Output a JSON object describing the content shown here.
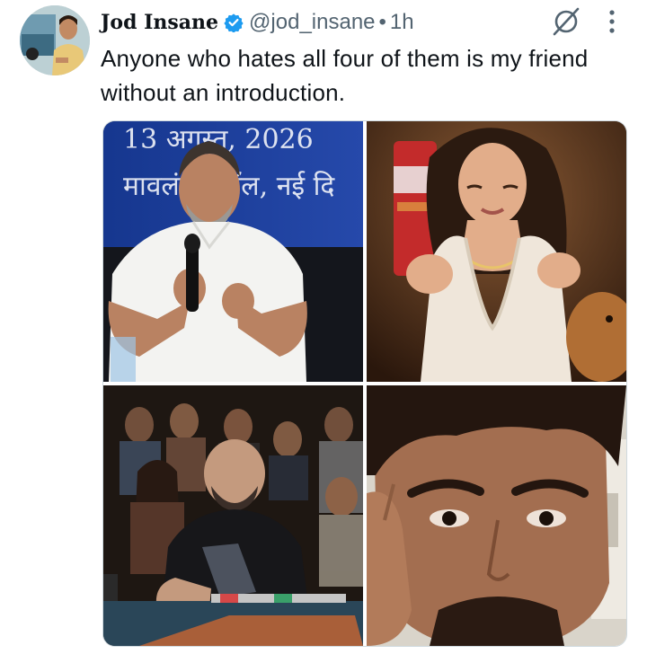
{
  "tweet": {
    "display_name": "Jod Insane",
    "handle": "@jod_insane",
    "separator": "•",
    "timestamp": "1h",
    "text": "Anyone who hates all four of them is my friend without an introduction.",
    "verified": true,
    "avatar_icon": "user-avatar"
  },
  "icons": {
    "verified": "verified-badge-icon",
    "grok": "grok-icon",
    "more": "more-options-icon"
  },
  "media": {
    "count": 4,
    "photo1": {
      "banner_line1": "13 अगस्त, 2026",
      "banner_line2": "मावलंकर हॉल, नई दि"
    }
  },
  "colors": {
    "verified_blue": "#1d9bf0",
    "text_primary": "#0f1419",
    "text_secondary": "#536471"
  }
}
